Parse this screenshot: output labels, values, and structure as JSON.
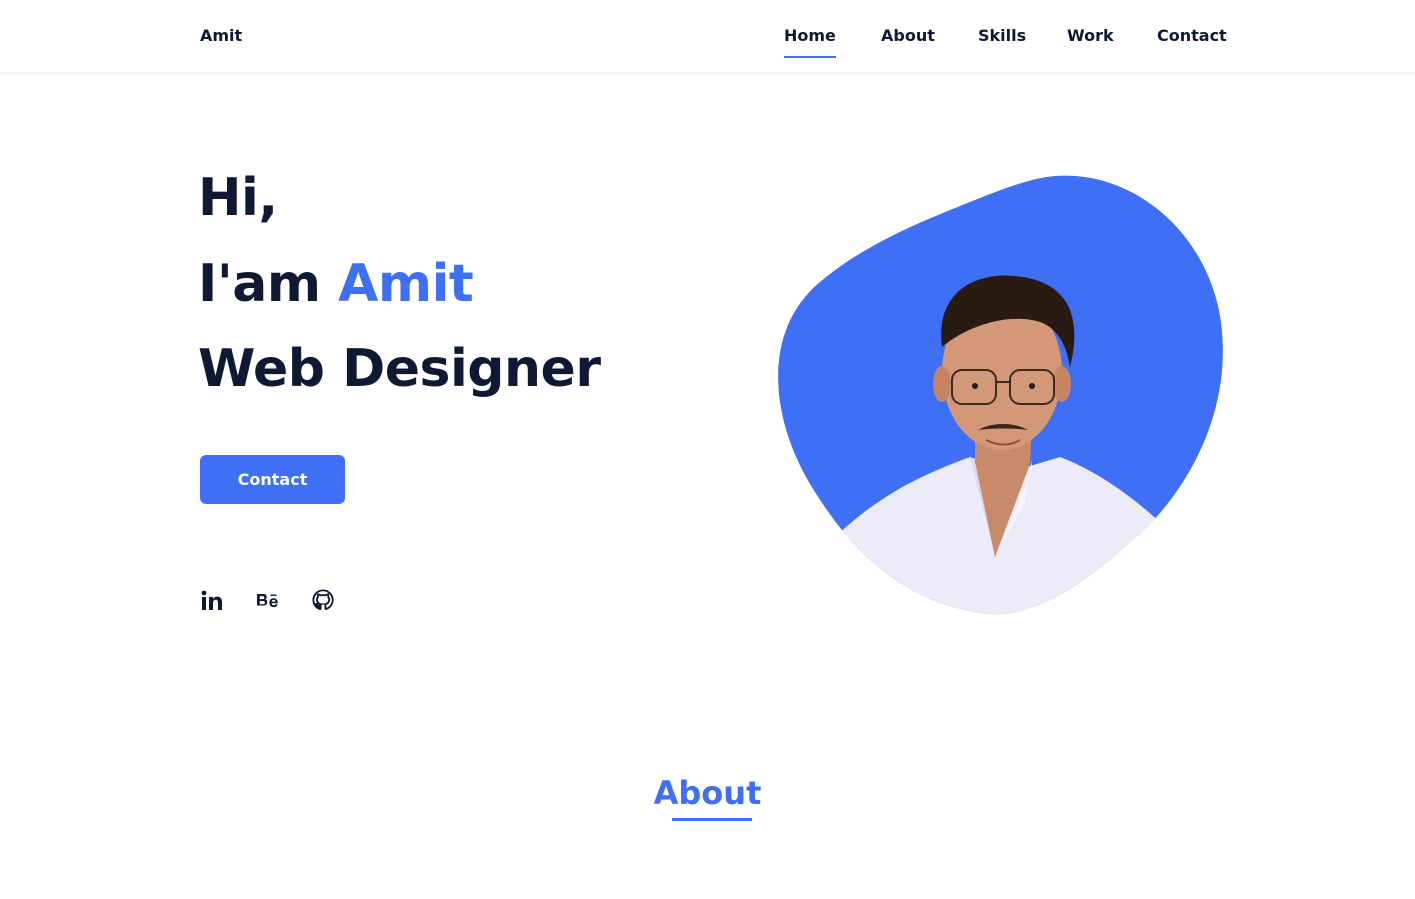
{
  "header": {
    "logo": "Amit",
    "nav": [
      {
        "label": "Home",
        "active": true
      },
      {
        "label": "About",
        "active": false
      },
      {
        "label": "Skills",
        "active": false
      },
      {
        "label": "Work",
        "active": false
      },
      {
        "label": "Contact",
        "active": false
      }
    ]
  },
  "hero": {
    "line1": "Hi,",
    "line2_prefix": "I'am",
    "line2_name": "Amit",
    "line3": "Web Designer",
    "button_label": "Contact",
    "social": [
      {
        "icon": "linkedin-icon",
        "label": "in"
      },
      {
        "icon": "behance-icon",
        "label": "Bē"
      },
      {
        "icon": "github-icon"
      }
    ],
    "image_alt": "profile-photo"
  },
  "about": {
    "title": "About"
  },
  "colors": {
    "accent": "#3e6ff4",
    "text": "#0e1a33",
    "background": "#ffffff"
  }
}
